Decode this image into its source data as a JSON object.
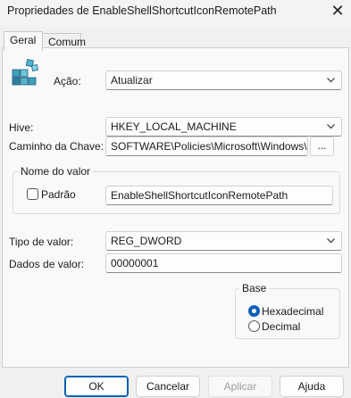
{
  "window": {
    "title": "Propriedades de EnableShellShortcutIconRemotePath",
    "close_glyph": "✕"
  },
  "tabs": [
    {
      "label": "Geral"
    },
    {
      "label": "Comum"
    }
  ],
  "form": {
    "acao_label": "Ação:",
    "acao_value": "Atualizar",
    "hive_label": "Hive:",
    "hive_value": "HKEY_LOCAL_MACHINE",
    "caminho_label": "Caminho da Chave:",
    "caminho_value": "SOFTWARE\\Policies\\Microsoft\\Windows\\Explo",
    "browse_label": "...",
    "nome_group_title": "Nome do valor",
    "padrao_label": "Padrão",
    "nome_value": "EnableShellShortcutIconRemotePath",
    "tipo_label": "Tipo de valor:",
    "tipo_value": "REG_DWORD",
    "dados_label": "Dados de valor:",
    "dados_value": "00000001",
    "base_title": "Base",
    "base_options": [
      {
        "label": "Hexadecimal",
        "selected": true
      },
      {
        "label": "Decimal",
        "selected": false
      }
    ]
  },
  "buttons": {
    "ok": "OK",
    "cancel": "Cancelar",
    "apply": "Aplicar",
    "help": "Ajuda"
  },
  "colors": {
    "accent": "#0a5fb4",
    "window_bg": "#f0f0f0",
    "panel_bg": "#f9f9f9",
    "disabled_text": "#9d9d9d"
  },
  "icons": {
    "registry": "registry-cubes-icon",
    "chevron": "chevron-down-icon"
  }
}
